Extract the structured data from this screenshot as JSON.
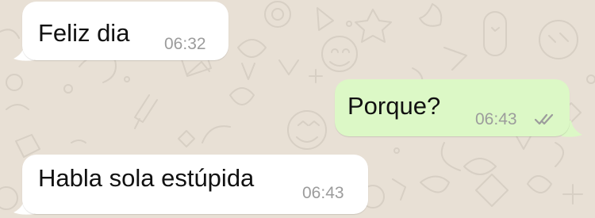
{
  "chat": {
    "messages": [
      {
        "id": "msg-1",
        "direction": "incoming",
        "text": "Feliz dia",
        "time": "06:32"
      },
      {
        "id": "msg-2",
        "direction": "outgoing",
        "text": "Porque?",
        "time": "06:43",
        "status": "double-check-icon"
      },
      {
        "id": "msg-3",
        "direction": "incoming",
        "text": "Habla sola estúpida",
        "time": "06:43"
      }
    ]
  },
  "colors": {
    "wallpaper": "#e8e0d5",
    "incoming_bubble": "#ffffff",
    "outgoing_bubble": "#dcf8c6",
    "message_text": "#111111",
    "timestamp": "#9c9c9c"
  }
}
